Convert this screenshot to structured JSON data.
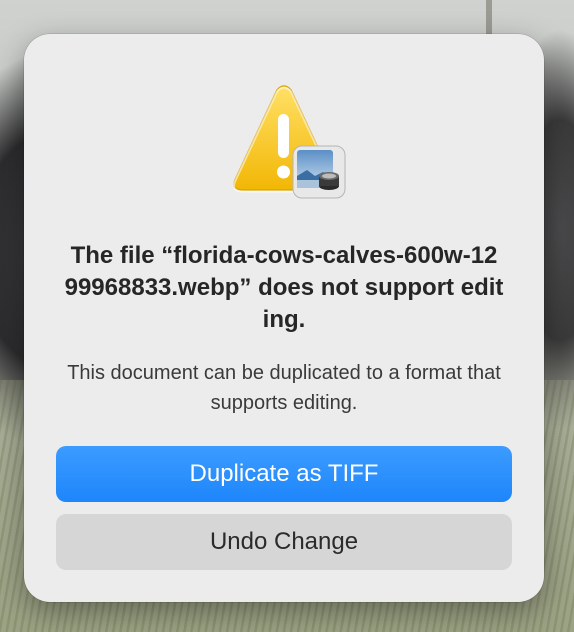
{
  "dialog": {
    "title": "The file “florida-cows-calves-600w-1299968833.webp” does not support editing.",
    "message": "This document can be duplicated to a format that supports editing.",
    "icon": "caution-triangle-with-preview-app-icon"
  },
  "buttons": {
    "primary_label": "Duplicate as TIFF",
    "secondary_label": "Undo Change"
  },
  "colors": {
    "accent": "#1e86fb",
    "warning": "#f5c400",
    "dialog_bg": "#ececec"
  }
}
